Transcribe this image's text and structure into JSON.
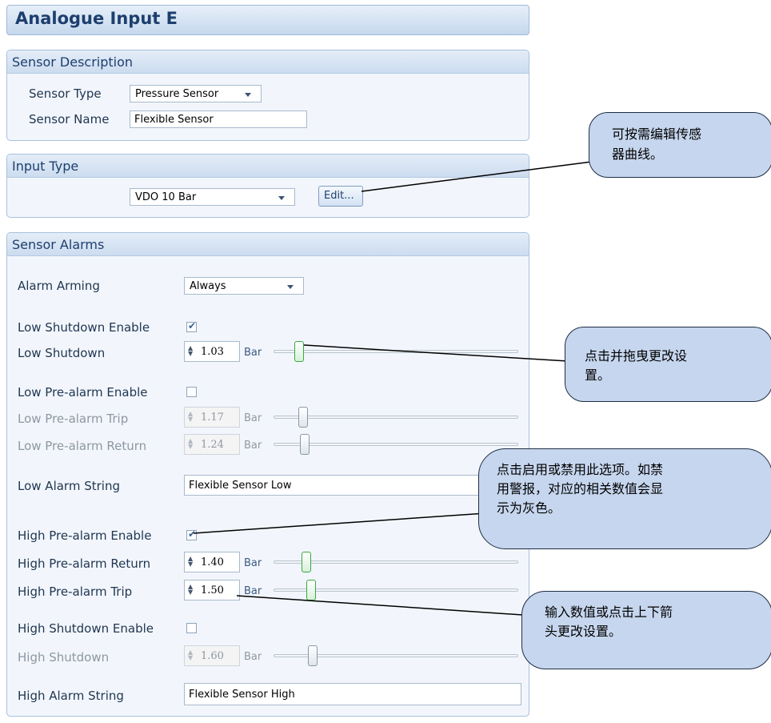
{
  "title": "Analogue Input E",
  "sensor_description": {
    "header": "Sensor Description",
    "type_label": "Sensor Type",
    "type_value": "Pressure Sensor",
    "name_label": "Sensor Name",
    "name_value": "Flexible Sensor"
  },
  "input_type": {
    "header": "Input Type",
    "value": "VDO 10 Bar",
    "edit_label": "Edit..."
  },
  "sensor_alarms": {
    "header": "Sensor Alarms",
    "arming_label": "Alarm Arming",
    "arming_value": "Always",
    "unit": "Bar",
    "low_shutdown_enable": {
      "label": "Low Shutdown Enable",
      "checked": true
    },
    "low_shutdown": {
      "label": "Low Shutdown",
      "value": "1.03",
      "enabled": true
    },
    "low_prealarm_enable": {
      "label": "Low Pre-alarm Enable",
      "checked": false
    },
    "low_prealarm_trip": {
      "label": "Low Pre-alarm Trip",
      "value": "1.17",
      "enabled": false
    },
    "low_prealarm_return": {
      "label": "Low Pre-alarm Return",
      "value": "1.24",
      "enabled": false
    },
    "low_alarm_string": {
      "label": "Low Alarm String",
      "value": "Flexible Sensor Low"
    },
    "high_prealarm_enable": {
      "label": "High Pre-alarm Enable",
      "checked": true
    },
    "high_prealarm_return": {
      "label": "High Pre-alarm Return",
      "value": "1.40",
      "enabled": true
    },
    "high_prealarm_trip": {
      "label": "High Pre-alarm Trip",
      "value": "1.50",
      "enabled": true
    },
    "high_shutdown_enable": {
      "label": "High Shutdown Enable",
      "checked": false
    },
    "high_shutdown": {
      "label": "High Shutdown",
      "value": "1.60",
      "enabled": false
    },
    "high_alarm_string": {
      "label": "High Alarm String",
      "value": "Flexible Sensor High"
    }
  },
  "callouts": {
    "edit_curve_1": "可按需编辑传感",
    "edit_curve_2": "器曲线。",
    "drag_1": "点击并拖曳更改设",
    "drag_2": "置。",
    "enable_1": "点击启用或禁用此选项。如禁",
    "enable_2": "用警报，对应的相关数值会显",
    "enable_3": "示为灰色。",
    "arrows_1": "输入数值或点击上下箭",
    "arrows_2": "头更改设置。"
  },
  "colors": {
    "accent": "#1d3f6e",
    "callout_fill": "#c6d6ee",
    "thumb_active": "#3aa845"
  }
}
